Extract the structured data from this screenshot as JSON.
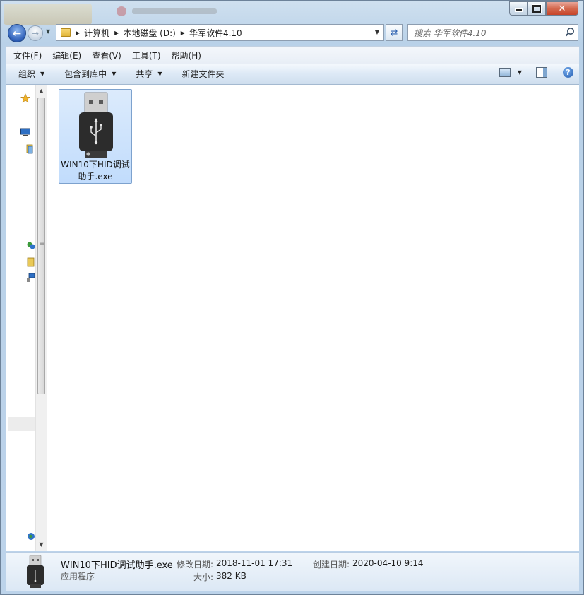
{
  "window": {
    "caption_buttons": {
      "minimize": "minimize",
      "maximize": "maximize",
      "close": "✕"
    }
  },
  "address": {
    "crumbs": [
      "计算机",
      "本地磁盘 (D:)",
      "华军软件4.10"
    ]
  },
  "search": {
    "placeholder": "搜索 华军软件4.10"
  },
  "menu": [
    "文件(F)",
    "编辑(E)",
    "查看(V)",
    "工具(T)",
    "帮助(H)"
  ],
  "toolbar": {
    "organize": "组织",
    "include_in_library": "包含到库中",
    "share": "共享",
    "new_folder": "新建文件夹"
  },
  "files": [
    {
      "name": "WIN10下HID调试助手.exe",
      "icon": "usb-drive-icon",
      "selected": true
    }
  ],
  "details": {
    "name": "WIN10下HID调试助手.exe",
    "type": "应用程序",
    "modified_label": "修改日期:",
    "modified_value": "2018-11-01 17:31",
    "created_label": "创建日期:",
    "created_value": "2020-04-10 9:14",
    "size_label": "大小:",
    "size_value": "382 KB"
  },
  "colors": {
    "selection_fill": "#c9e0fc",
    "selection_border": "#7da2ce",
    "window_frame": "#b9d1e8"
  }
}
